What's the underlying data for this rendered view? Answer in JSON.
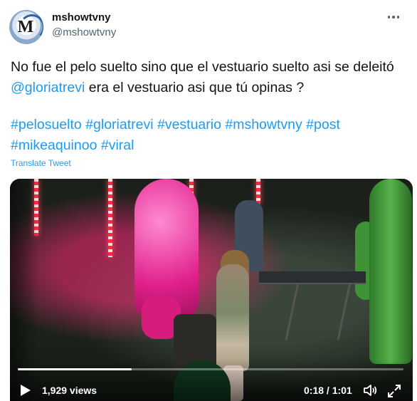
{
  "author": {
    "display_name": "mshowtvny",
    "handle": "@mshowtvny",
    "avatar_mark": "M"
  },
  "tweet": {
    "text_before": "No fue el pelo suelto sino que el vestuario suelto asi se deleitó ",
    "mention": "@gloriatrevi",
    "text_after": " era el vestuario asi que tú opinas ?",
    "hashtags": [
      "#pelosuelto",
      "#gloriatrevi",
      "#vestuario",
      "#mshowtvny",
      "#post",
      "#mikeaquinoo",
      "#viral"
    ],
    "translate_label": "Translate Tweet"
  },
  "video": {
    "views": "1,929 views",
    "time": "0:18 / 1:01",
    "progress": 0.295
  },
  "colors": {
    "accent": "#1d9bf0",
    "text": "#0f1419",
    "muted": "#536471"
  },
  "icons": {
    "more": "more-icon",
    "play": "play-icon",
    "volume": "volume-icon",
    "expand": "expand-icon"
  }
}
